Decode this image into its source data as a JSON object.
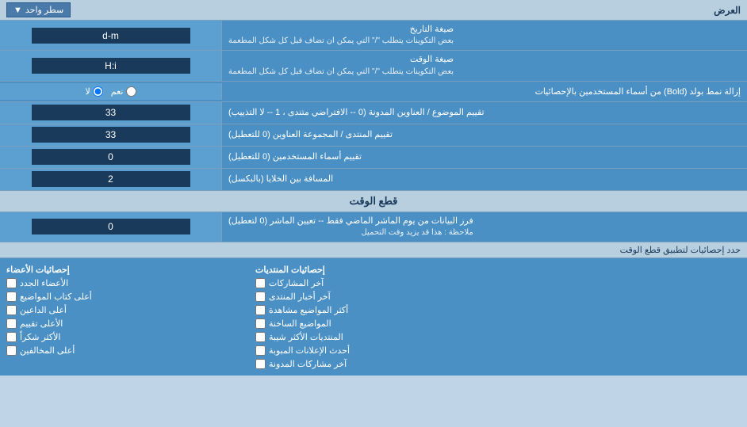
{
  "header": {
    "title": "العرض",
    "dropdown_label": "سطر واحد",
    "dropdown_arrow": "▼"
  },
  "rows": [
    {
      "id": "date-format",
      "label": "صيغة التاريخ",
      "sublabel": "بعض التكوينات يتطلب \"/\" التي يمكن ان تضاف قبل كل شكل المطعمة",
      "value": "d-m"
    },
    {
      "id": "time-format",
      "label": "صيغة الوقت",
      "sublabel": "بعض التكوينات يتطلب \"/\" التي يمكن ان تضاف قبل كل شكل المطعمة",
      "value": "H:i"
    },
    {
      "id": "bold-remove",
      "label": "إزالة نمط بولد (Bold) من أسماء المستخدمين بالإحصائيات",
      "radio_yes": "نعم",
      "radio_no": "لا",
      "selected": "no"
    },
    {
      "id": "topic-order",
      "label": "تقييم الموضوع / العناوين المدونة (0 -- الافتراضي متندى ، 1 -- لا التذييب)",
      "value": "33"
    },
    {
      "id": "forum-order",
      "label": "تقييم المنتدى / المجموعة العناوين (0 للتعطيل)",
      "value": "33"
    },
    {
      "id": "user-order",
      "label": "تقييم أسماء المستخدمين (0 للتعطيل)",
      "value": "0"
    },
    {
      "id": "cell-spacing",
      "label": "المسافة بين الخلايا (بالبكسل)",
      "value": "2"
    }
  ],
  "cutoff_section": {
    "title": "قطع الوقت",
    "main_row": {
      "label": "فرز البيانات من يوم الماشر الماضي فقط -- تعيين الماشر (0 لتعطيل)",
      "note": "ملاحظة : هذا قد يزيد وقت التحميل",
      "value": "0"
    },
    "limit_row": "حدد إحصائيات لتطبيق قطع الوقت"
  },
  "checkboxes": {
    "col1": {
      "header": "إحصائيات الأعضاء",
      "items": [
        "الأعضاء الجدد",
        "أعلى كتاب المواضيع",
        "أعلى الداعين",
        "الأعلى تقييم",
        "الأكثر شكراً",
        "أعلى المخالفين"
      ]
    },
    "col2": {
      "header": "إحصائيات المنتديات",
      "items": [
        "آخر المشاركات",
        "آخر أخبار المنتدى",
        "أكثر المواضيع مشاهدة",
        "المواضيع الساخنة",
        "المنتديات الأكثر شيبة",
        "أحدث الإعلانات المبوبة",
        "آخر مشاركات المدونة"
      ]
    },
    "col3": {
      "header": "",
      "items": []
    }
  }
}
